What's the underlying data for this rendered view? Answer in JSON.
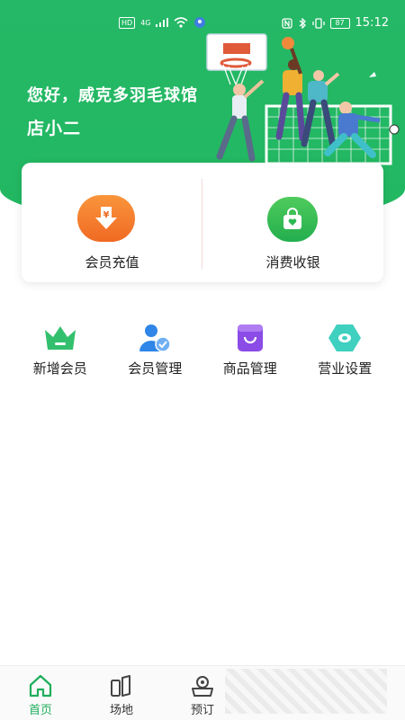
{
  "status_bar": {
    "left_chips": [
      "HD",
      "4G"
    ],
    "time": "15:12",
    "battery": "87"
  },
  "hero": {
    "greeting": "您好，威克多羽毛球馆",
    "shop_name": "店小二"
  },
  "actions": [
    {
      "label": "会员充值",
      "icon": "yen-download-icon",
      "color": "#f47a2a"
    },
    {
      "label": "消费收银",
      "icon": "shopping-bag-heart-icon",
      "color": "#2eb957"
    }
  ],
  "quick_links": [
    {
      "label": "新增会员",
      "icon": "crown-icon",
      "color": "#33c06e"
    },
    {
      "label": "会员管理",
      "icon": "user-check-icon",
      "color": "#2f86e8"
    },
    {
      "label": "商品管理",
      "icon": "shopping-box-icon",
      "color": "#8a4be6"
    },
    {
      "label": "营业设置",
      "icon": "hexagon-settings-icon",
      "color": "#3fd0c0"
    }
  ],
  "tabs": [
    {
      "label": "首页",
      "icon": "home-icon",
      "active": true
    },
    {
      "label": "场地",
      "icon": "court-icon",
      "active": false
    },
    {
      "label": "预订",
      "icon": "booking-icon",
      "active": false
    }
  ],
  "colors": {
    "brand_green": "#22b862",
    "accent_orange": "#f47a2a",
    "active_tab": "#1fae5d"
  }
}
